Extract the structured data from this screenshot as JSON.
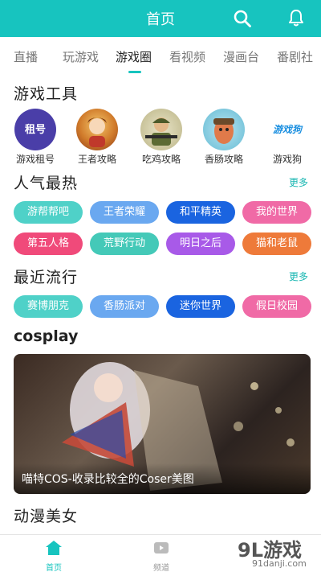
{
  "header": {
    "title": "首页"
  },
  "tabs": [
    {
      "label": "直播"
    },
    {
      "label": "玩游戏"
    },
    {
      "label": "游戏圈"
    },
    {
      "label": "看视频"
    },
    {
      "label": "漫画台"
    },
    {
      "label": "番剧社"
    }
  ],
  "tools": {
    "title": "游戏工具",
    "items": [
      {
        "label": "游戏租号",
        "icon_text": "租号"
      },
      {
        "label": "王者攻略"
      },
      {
        "label": "吃鸡攻略"
      },
      {
        "label": "香肠攻略"
      },
      {
        "label": "游戏狗",
        "icon_text": "游戏狗"
      }
    ]
  },
  "popular": {
    "title": "人气最热",
    "more": "更多",
    "pills": [
      {
        "label": "游帮帮吧",
        "color": "#4fd1c8"
      },
      {
        "label": "王者荣耀",
        "color": "#6aa8f0"
      },
      {
        "label": "和平精英",
        "color": "#1a64e0"
      },
      {
        "label": "我的世界",
        "color": "#f06aa6"
      },
      {
        "label": "第五人格",
        "color": "#f04a7a"
      },
      {
        "label": "荒野行动",
        "color": "#44c9b8"
      },
      {
        "label": "明日之后",
        "color": "#a85ae8"
      },
      {
        "label": "猫和老鼠",
        "color": "#ee7a3a"
      }
    ]
  },
  "recent": {
    "title": "最近流行",
    "more": "更多",
    "pills": [
      {
        "label": "赛博朋克",
        "color": "#4fd1c8"
      },
      {
        "label": "香肠派对",
        "color": "#6aa8f0"
      },
      {
        "label": "迷你世界",
        "color": "#1a64e0"
      },
      {
        "label": "假日校园",
        "color": "#f06aa6"
      }
    ]
  },
  "cosplay": {
    "title": "cosplay",
    "caption": "喵特COS-收录比较全的Coser美图"
  },
  "anime": {
    "title": "动漫美女"
  },
  "bottom_nav": [
    {
      "label": "首页",
      "color": "#17c4bf"
    },
    {
      "label": "频道",
      "color": "#999999"
    }
  ],
  "watermark": {
    "text": "9L游戏",
    "sub": "91danji.com"
  }
}
